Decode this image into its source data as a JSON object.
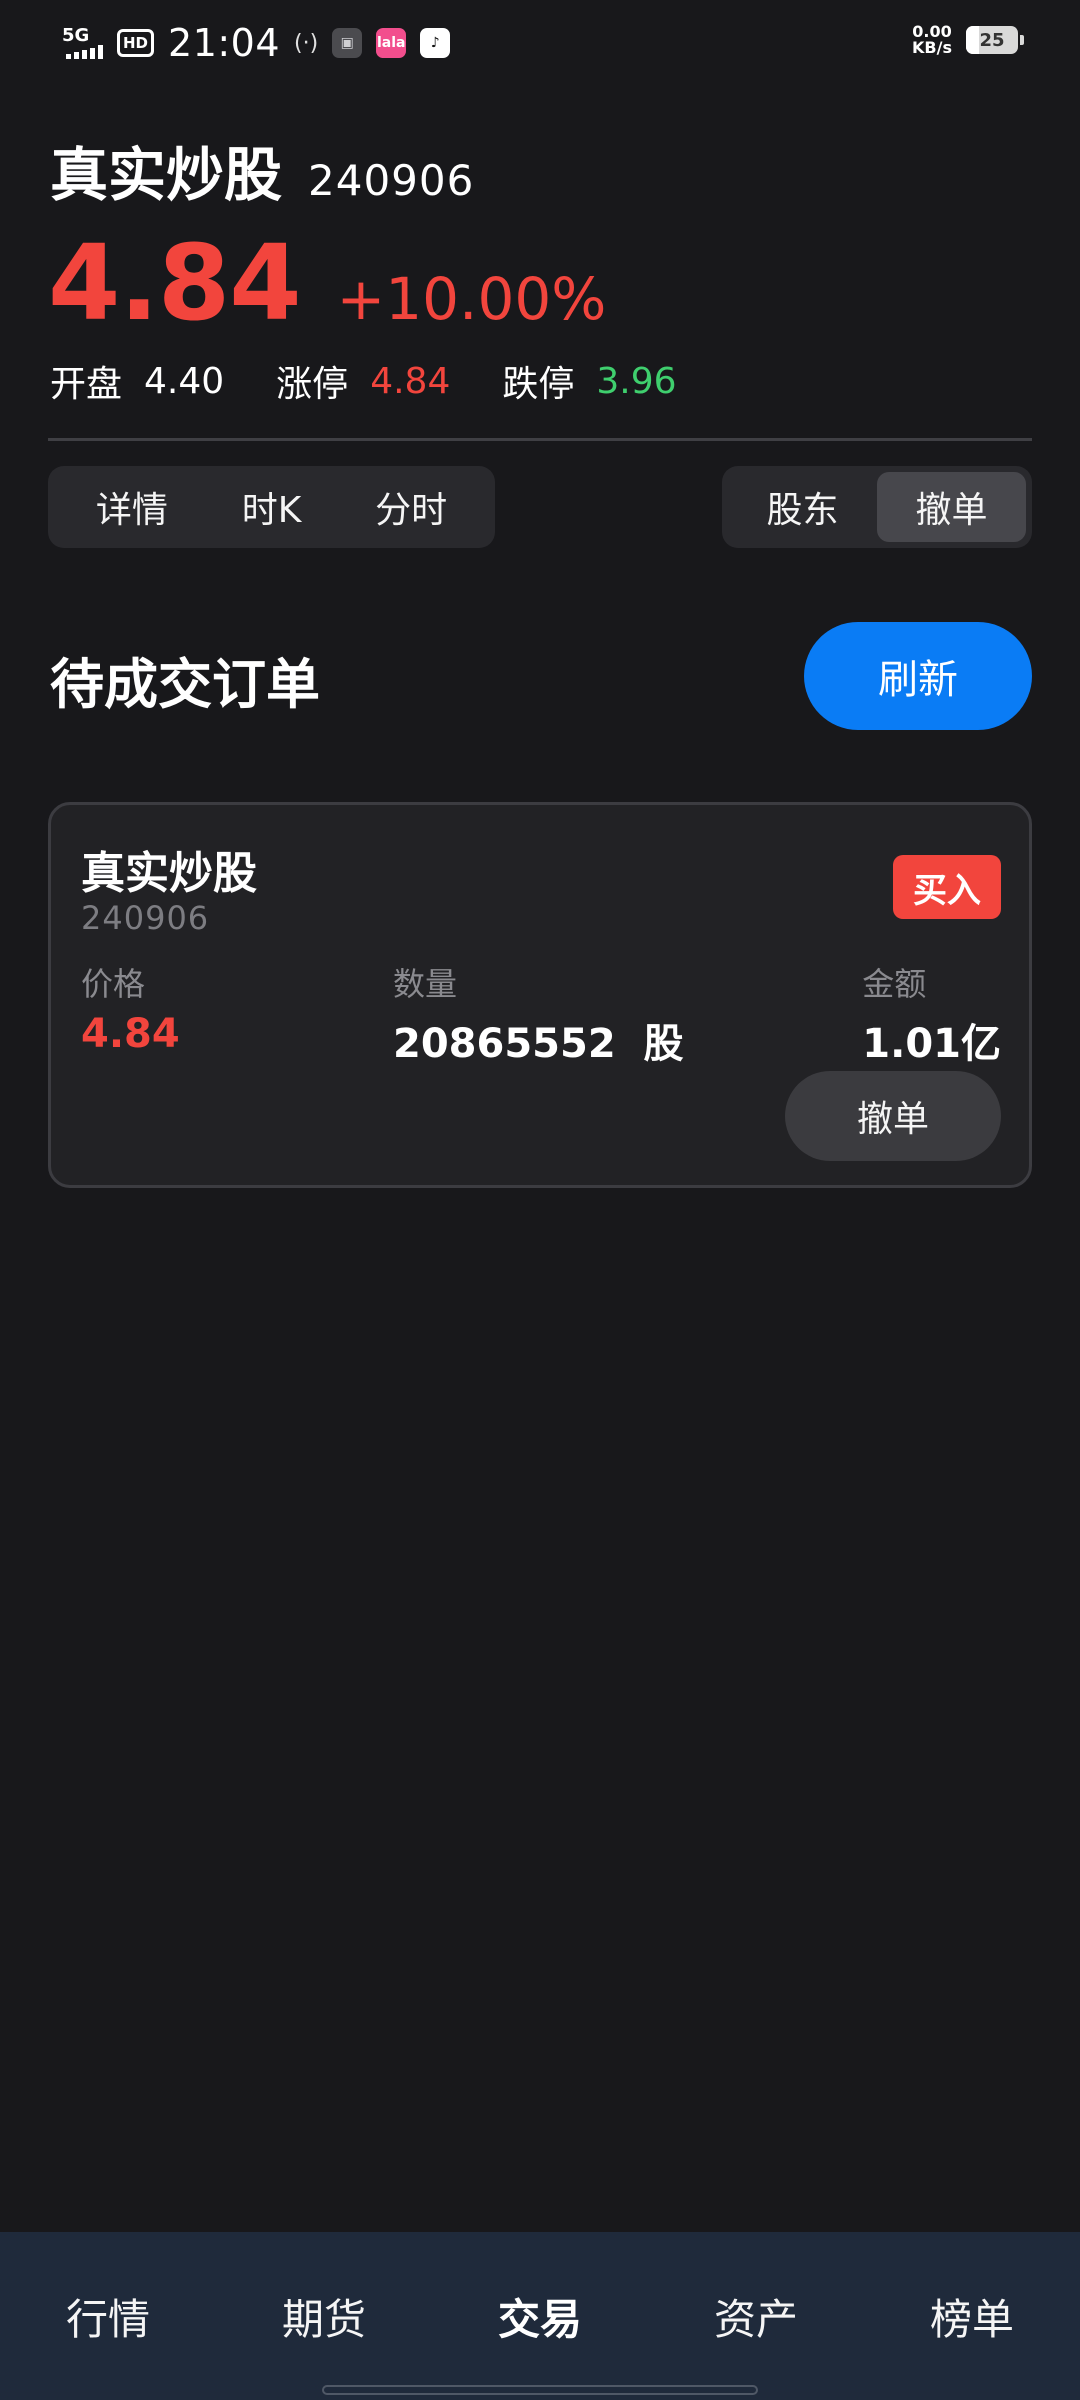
{
  "status_bar": {
    "network": "5G",
    "hd": "HD",
    "time": "21:04",
    "radio": "(·)",
    "app_icons": [
      "▣",
      "lala",
      "♪"
    ],
    "net_speed_value": "0.00",
    "net_speed_unit": "KB/s",
    "battery": "25"
  },
  "stock": {
    "name": "真实炒股",
    "code": "240906",
    "price": "4.84",
    "change": "+10.00%",
    "stats": [
      {
        "label": "开盘",
        "value": "4.40"
      },
      {
        "label": "涨停",
        "value": "4.84"
      },
      {
        "label": "跌停",
        "value": "3.96"
      }
    ]
  },
  "view_tabs": [
    "详情",
    "时K",
    "分时"
  ],
  "action_tabs": [
    "股东",
    "撤单"
  ],
  "pending": {
    "title": "待成交订单",
    "refresh_label": "刷新"
  },
  "order": {
    "name": "真实炒股",
    "code": "240906",
    "side": "买入",
    "price_label": "价格",
    "price": "4.84",
    "qty_label": "数量",
    "qty": "20865552  股",
    "amount_label": "金额",
    "amount": "1.01亿",
    "cancel_label": "撤单"
  },
  "bottom_nav": [
    "行情",
    "期货",
    "交易",
    "资产",
    "榜单"
  ],
  "colors": {
    "up_red": "#f2453d",
    "down_green": "#3fcf6e",
    "accent_blue": "#0a7cf5"
  }
}
